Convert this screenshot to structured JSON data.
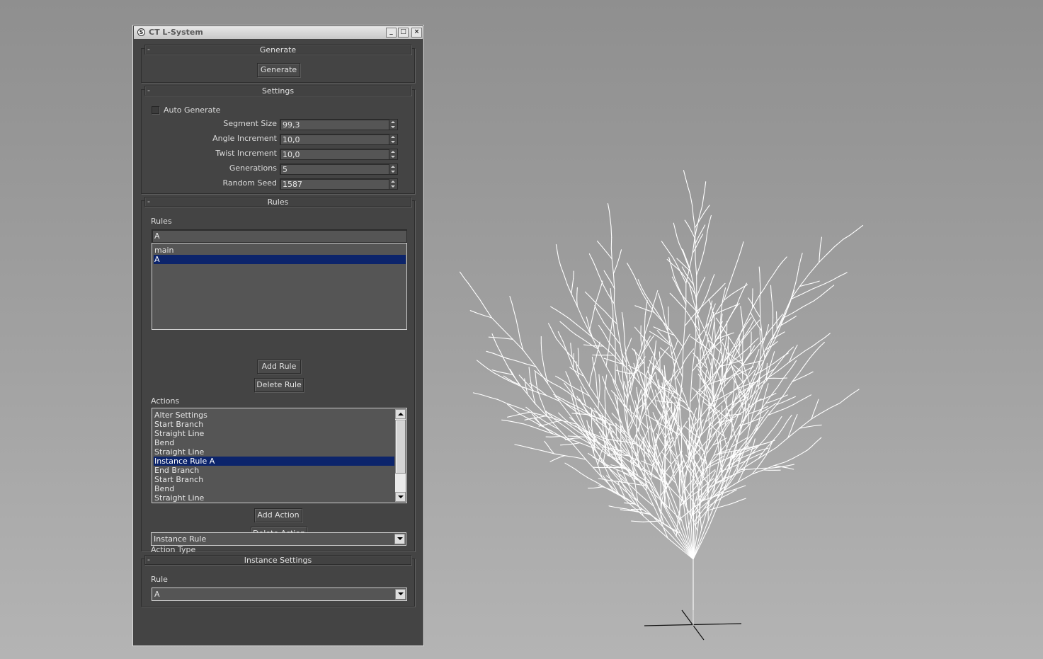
{
  "window": {
    "title": "CT L-System",
    "app_icon_glyph": "S",
    "minimize_glyph": "_",
    "maximize_glyph": "□",
    "close_glyph": "×"
  },
  "generate_panel": {
    "collapse_glyph": "-",
    "title": "Generate",
    "button_label": "Generate"
  },
  "settings_panel": {
    "collapse_glyph": "-",
    "title": "Settings",
    "auto_generate": {
      "label": "Auto Generate",
      "checked": false
    },
    "fields": [
      {
        "label": "Segment Size",
        "value": "99,3"
      },
      {
        "label": "Angle Increment",
        "value": "10,0"
      },
      {
        "label": "Twist Increment",
        "value": "10,0"
      },
      {
        "label": "Generations",
        "value": "5"
      },
      {
        "label": "Random Seed",
        "value": "1587"
      }
    ]
  },
  "rules_panel": {
    "collapse_glyph": "-",
    "title": "Rules",
    "rules_label": "Rules",
    "rule_name_value": "A",
    "rules": [
      "main",
      "A"
    ],
    "selected_rule": "A",
    "add_rule_label": "Add Rule",
    "delete_rule_label": "Delete Rule",
    "actions_label": "Actions",
    "actions": [
      "Alter Settings",
      "Start Branch",
      "Straight Line",
      "Bend",
      "Straight Line",
      "Instance Rule A",
      "End Branch",
      "Start Branch",
      "Bend",
      "Straight Line"
    ],
    "selected_action": "Instance Rule A",
    "add_action_label": "Add Action",
    "delete_action_label": "Delete Action",
    "action_type_label": "Action Type",
    "action_type_value": "Instance Rule"
  },
  "instance_panel": {
    "collapse_glyph": "-",
    "title": "Instance Settings",
    "rule_label": "Rule",
    "rule_value": "A"
  },
  "colors": {
    "viewport_top": "#8f8f8f",
    "viewport_bottom": "#b4b4b4",
    "panel_bg": "#444444",
    "selection": "#0c246b",
    "tree_line": "#ffffff"
  }
}
